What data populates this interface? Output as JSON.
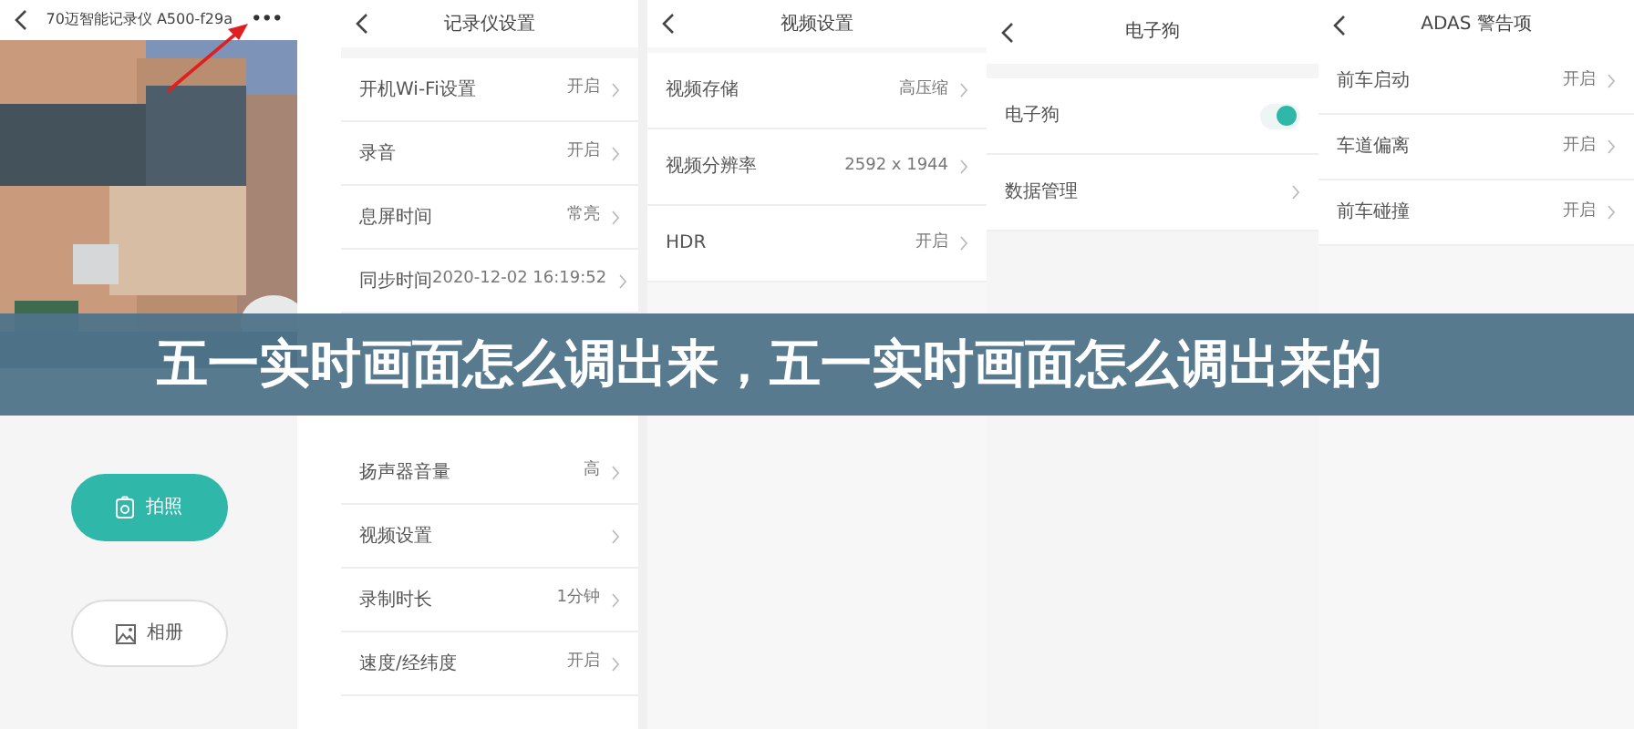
{
  "camera_screen": {
    "title": "70迈智能记录仪 A500-f29a",
    "more": "•••",
    "buttons": [
      {
        "label": "拍照",
        "kind": "primary"
      },
      {
        "label": "相册",
        "kind": "secondary"
      }
    ]
  },
  "recorder_settings": {
    "title": "记录仪设置",
    "rows": [
      {
        "label": "开机Wi-Fi设置",
        "value": "开启"
      },
      {
        "label": "录音",
        "value": "开启"
      },
      {
        "label": "息屏时间",
        "value": "常亮"
      },
      {
        "label": "同步时间",
        "value": "2020-12-02 16:19:52"
      }
    ],
    "rows_below_banner": [
      {
        "label": "扬声器音量",
        "value": "高"
      },
      {
        "label": "视频设置"
      },
      {
        "label": "录制时长",
        "value": "1分钟"
      },
      {
        "label": "速度/经纬度",
        "value": "开启"
      }
    ]
  },
  "video_settings": {
    "title": "视频设置",
    "rows": [
      {
        "label": "视频存储",
        "value": "高压缩"
      },
      {
        "label": "视频分辨率",
        "value": "2592 x 1944"
      },
      {
        "label": "HDR",
        "value": "开启"
      }
    ]
  },
  "speed_camera": {
    "title": "电子狗",
    "rows": [
      {
        "kind": "toggle",
        "label": "电子狗",
        "on": true
      },
      {
        "kind": "link",
        "label": "数据管理"
      }
    ]
  },
  "adas": {
    "title": "ADAS 警告项",
    "rows": [
      {
        "label": "前车启动",
        "value": "开启"
      },
      {
        "label": "车道偏离",
        "value": "开启"
      },
      {
        "label": "前车碰撞",
        "value": "开启"
      }
    ]
  },
  "banner": {
    "title": "五一实时画面怎么调出来，五一实时画面怎么调出来的"
  }
}
